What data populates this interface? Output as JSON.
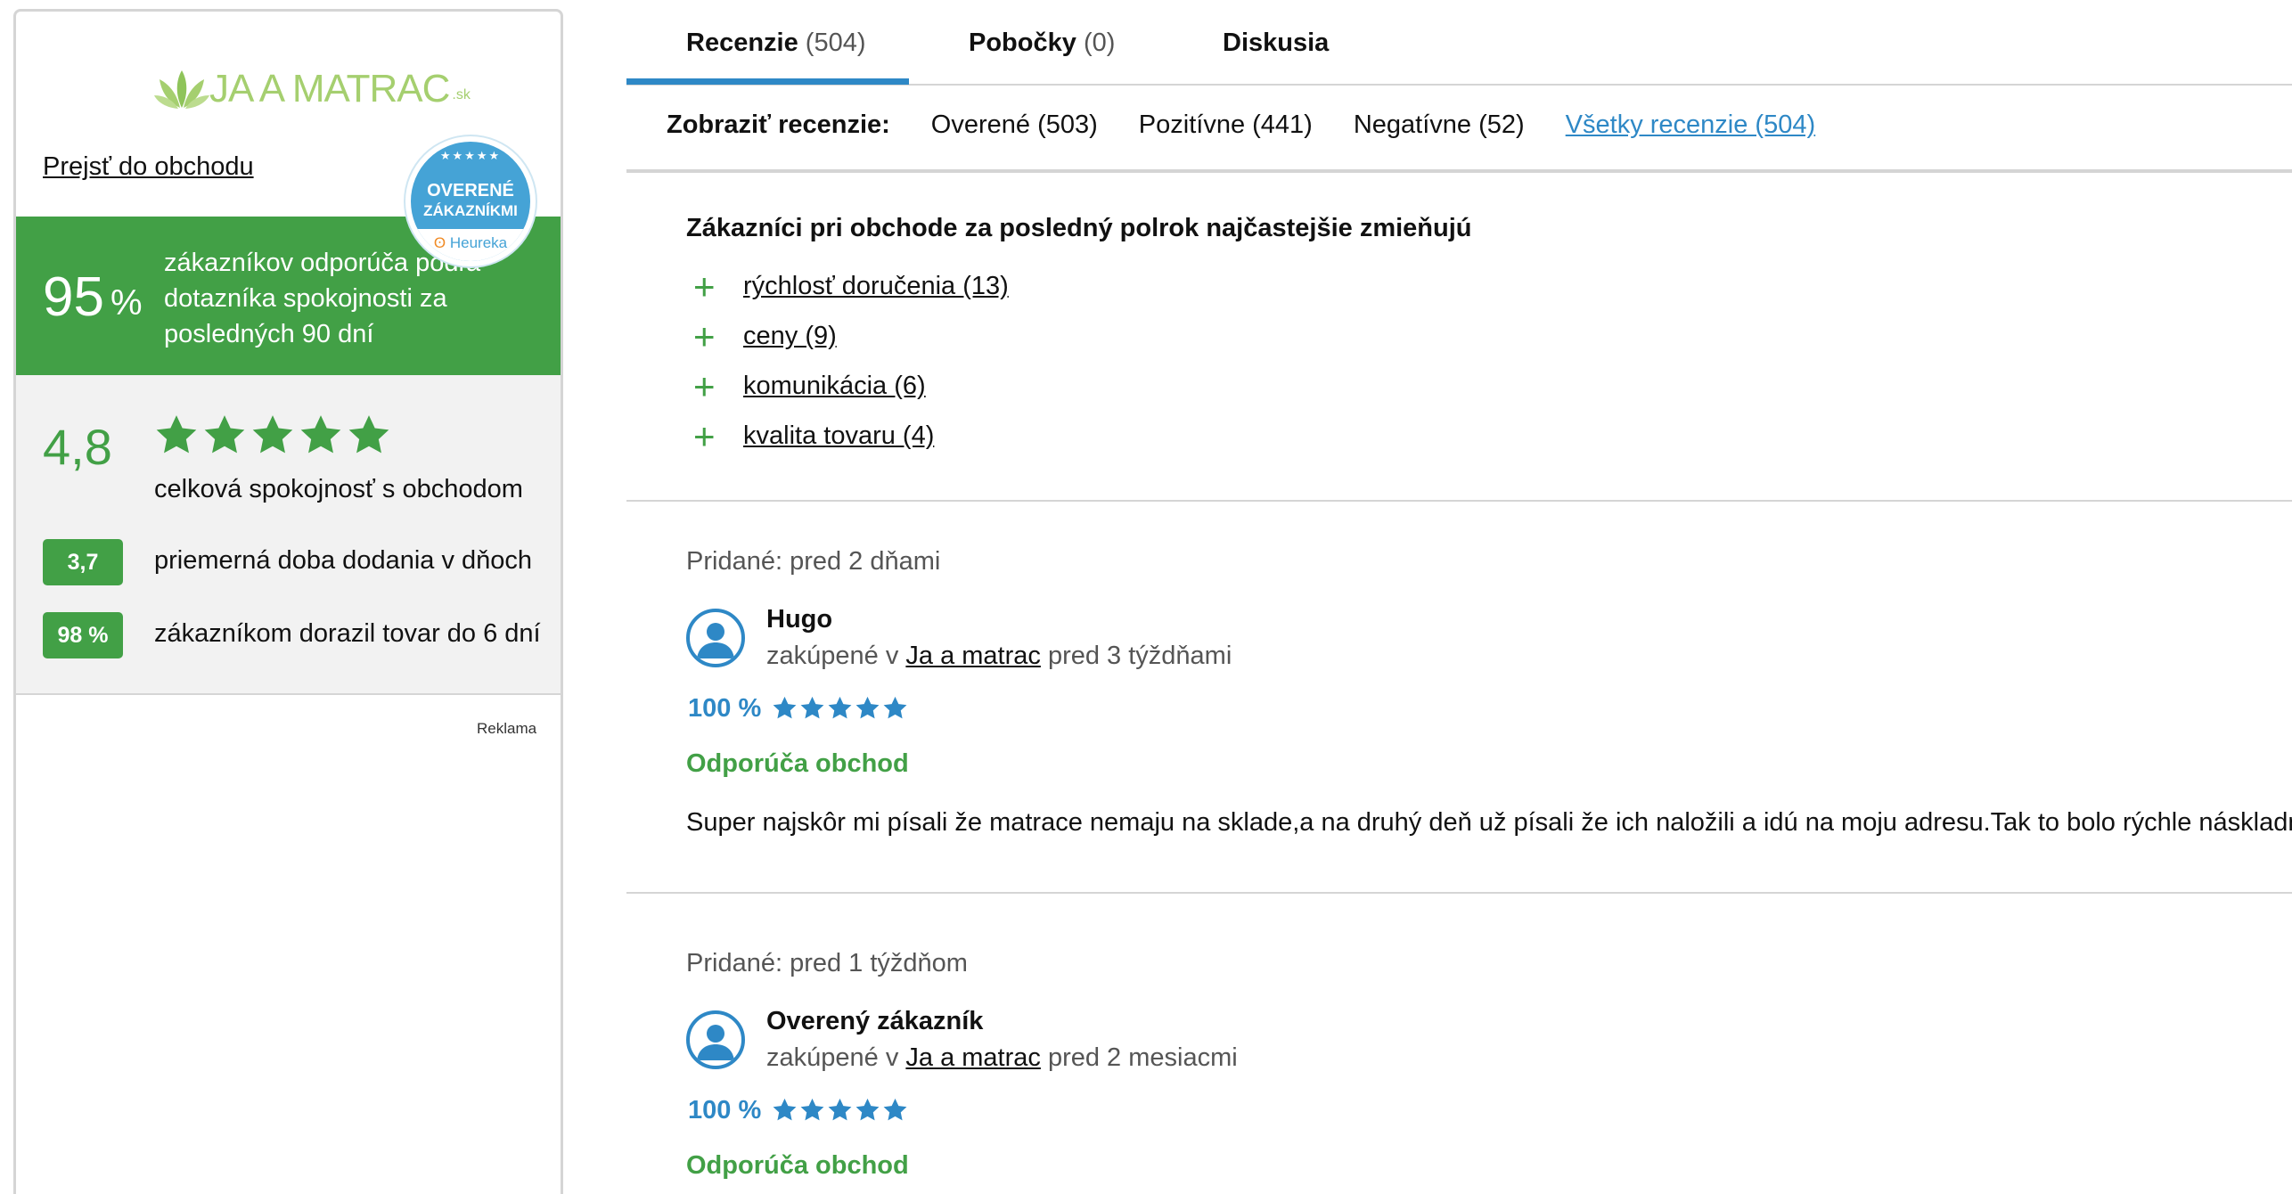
{
  "sidebar": {
    "logo": {
      "text": "JA A MATRAC",
      "suffix": ".sk"
    },
    "shop_link": "Prejsť do obchodu",
    "badge": {
      "line1": "OVERENÉ",
      "line2": "ZÁKAZNÍKMI",
      "brand": "Heureka"
    },
    "recommend_pct": "95",
    "recommend_pct_sign": "%",
    "recommend_text": "zákazníkov odporúča podľa dotazníka spokojnosti za posledných 90 dní",
    "rating": "4,8",
    "rating_stars": 5,
    "rating_label": "celková spokojnosť s obchodom",
    "delivery_days": "3,7",
    "delivery_label": "priemerná doba dodania v dňoch",
    "delivered_pct": "98 %",
    "delivered_label": "zákazníkom dorazil tovar do 6 dní",
    "ad_label": "Reklama"
  },
  "tabs": [
    {
      "label": "Recenzie",
      "count": "(504)",
      "active": true
    },
    {
      "label": "Pobočky",
      "count": "(0)",
      "active": false
    },
    {
      "label": "Diskusia",
      "count": "",
      "active": false
    }
  ],
  "filters": {
    "label": "Zobraziť recenzie:",
    "items": [
      "Overené (503)",
      "Pozitívne (441)",
      "Negatívne (52)"
    ],
    "all": "Všetky recenzie (504)"
  },
  "mentions": {
    "title": "Zákazníci pri obchode za posledný polrok najčastejšie zmieňujú",
    "items": [
      "rýchlosť doručenia (13)",
      "ceny (9)",
      "komunikácia (6)",
      "kvalita tovaru (4)"
    ]
  },
  "reviews": [
    {
      "added": "Pridané: pred 2 dňami",
      "author": "Hugo",
      "bought_prefix": "zakúpené v",
      "shop": "Ja a matrac",
      "bought_suffix": "pred 3 týždňami",
      "score": "100 %",
      "stars": 5,
      "recommend": "Odporúča obchod",
      "text": "Super najskôr mi písali že matrace nemaju na sklade,a na druhý deň už písali že ich naložili a idú na moju adresu.Tak to bolo rýchle náskladnenie"
    },
    {
      "added": "Pridané: pred 1 týždňom",
      "author": "Overený zákazník",
      "bought_prefix": "zakúpené v",
      "shop": "Ja a matrac",
      "bought_suffix": "pred 2 mesiacmi",
      "score": "100 %",
      "stars": 5,
      "recommend": "Odporúča obchod"
    }
  ],
  "colors": {
    "green": "#42a046",
    "blue": "#2e88c6",
    "logo_green": "#a5cf6f"
  }
}
